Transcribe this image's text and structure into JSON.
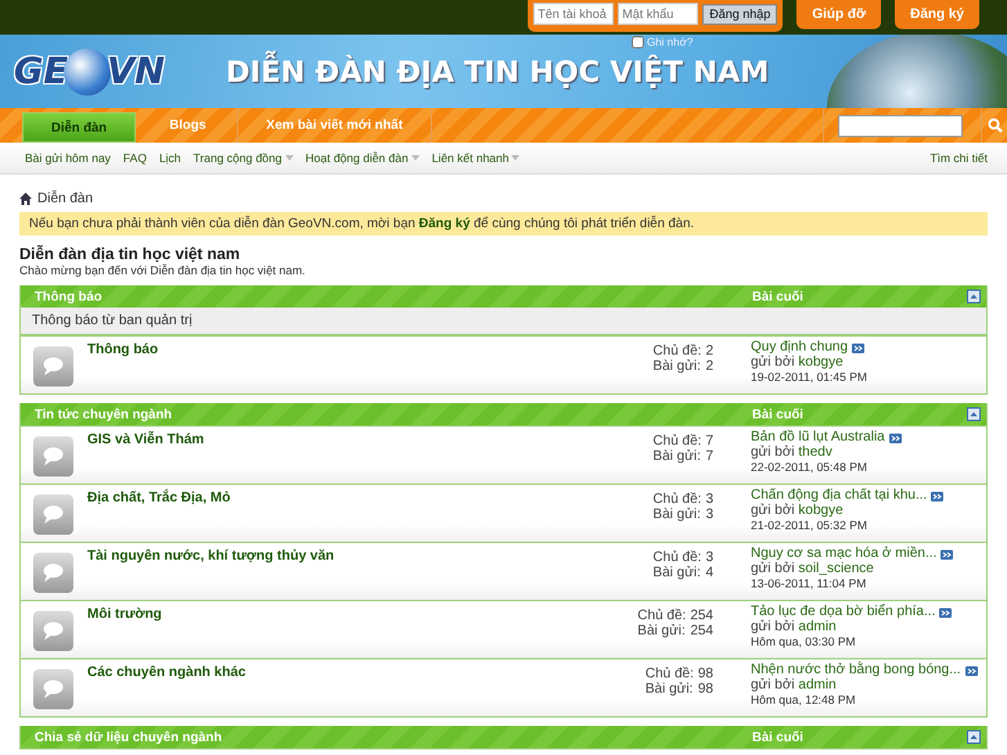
{
  "login": {
    "username": {
      "placeholder": "Tên tài khoả"
    },
    "password": {
      "placeholder": "Mật khẩu"
    },
    "submit": "Đăng nhập",
    "remember": {
      "label": "Ghi nhớ?",
      "checked": false
    }
  },
  "top_buttons": [
    "Giúp đỡ",
    "Đăng ký"
  ],
  "logo": {
    "left": "GE",
    "right": "VN"
  },
  "banner_title": "DIỄN ĐÀN ĐỊA TIN HỌC VIỆT NAM",
  "nav_tabs": [
    {
      "label": "Diễn đàn",
      "selected": true
    },
    {
      "label": "Blogs",
      "selected": false
    },
    {
      "label": "Xem bài viết mới nhất",
      "selected": false
    }
  ],
  "sub_nav": [
    {
      "label": "Bài gửi hôm nay",
      "dropdown": false
    },
    {
      "label": "FAQ",
      "dropdown": false
    },
    {
      "label": "Lịch",
      "dropdown": false
    },
    {
      "label": "Trang cộng đồng",
      "dropdown": true
    },
    {
      "label": "Hoạt động diễn đàn",
      "dropdown": true
    },
    {
      "label": "Liên kết nhanh",
      "dropdown": true
    }
  ],
  "advanced_search": "Tìm chi tiết",
  "breadcrumb": "Diễn đàn",
  "notice": "Nếu bạn chưa phải thành viên của diễn đàn GeoVN.com, mời bạn **Đăng ký** để cùng chúng tôi phát triển diễn đàn.",
  "forum_title": "Diễn đàn địa tin học việt nam",
  "forum_subtitle": "Chào mừng bạn đến với Diễn đàn địa tin học việt nam.",
  "sections": [
    {
      "title": "Thông báo",
      "last_label": "Bài cuối",
      "description": "Thông báo từ ban quản trị",
      "forums": [
        {
          "name": "Thông báo",
          "topics_label": "Chủ đề:",
          "topics": "2",
          "posts_label": "Bài gửi:",
          "posts": "2",
          "last_title": "Quy định chung",
          "by": "gửi bởi",
          "author": "kobgye",
          "date": "19-02-2011, 01:45 PM"
        }
      ]
    },
    {
      "title": "Tin tức chuyên ngành",
      "last_label": "Bài cuối",
      "forums": [
        {
          "name": "GIS và Viễn Thám",
          "topics_label": "Chủ đề:",
          "topics": "7",
          "posts_label": "Bài gửi:",
          "posts": "7",
          "last_title": "Bản đồ lũ lụt Australia",
          "by": "gửi bởi",
          "author": "thedv",
          "date": "22-02-2011, 05:48 PM"
        },
        {
          "name": "Địa chất, Trắc Địa, Mỏ",
          "topics_label": "Chủ đề:",
          "topics": "3",
          "posts_label": "Bài gửi:",
          "posts": "3",
          "last_title": "Chấn động địa chất tại khu...",
          "by": "gửi bởi",
          "author": "kobgye",
          "date": "21-02-2011, 05:32 PM"
        },
        {
          "name": "Tài nguyên nước, khí tượng thủy văn",
          "topics_label": "Chủ đề:",
          "topics": "3",
          "posts_label": "Bài gửi:",
          "posts": "4",
          "last_title": "Nguy cơ sa mạc hóa ở miền...",
          "by": "gửi bởi",
          "author": "soil_science",
          "date": "13-06-2011, 11:04 PM"
        },
        {
          "name": "Môi trường",
          "topics_label": "Chủ đề:",
          "topics": "254",
          "posts_label": "Bài gửi:",
          "posts": "254",
          "last_title": "Tảo lục đe dọa bờ biển phía...",
          "by": "gửi bởi",
          "author": "admin",
          "date": "Hôm qua, 03:30 PM"
        },
        {
          "name": "Các chuyên ngành khác",
          "topics_label": "Chủ đề:",
          "topics": "98",
          "posts_label": "Bài gửi:",
          "posts": "98",
          "last_title": "Nhện nước thở bằng bong bóng...",
          "by": "gửi bởi",
          "author": "admin",
          "date": "Hôm qua, 12:48 PM"
        }
      ]
    },
    {
      "title": "Chia sẻ dữ liệu chuyên ngành",
      "last_label": "Bài cuối"
    }
  ]
}
